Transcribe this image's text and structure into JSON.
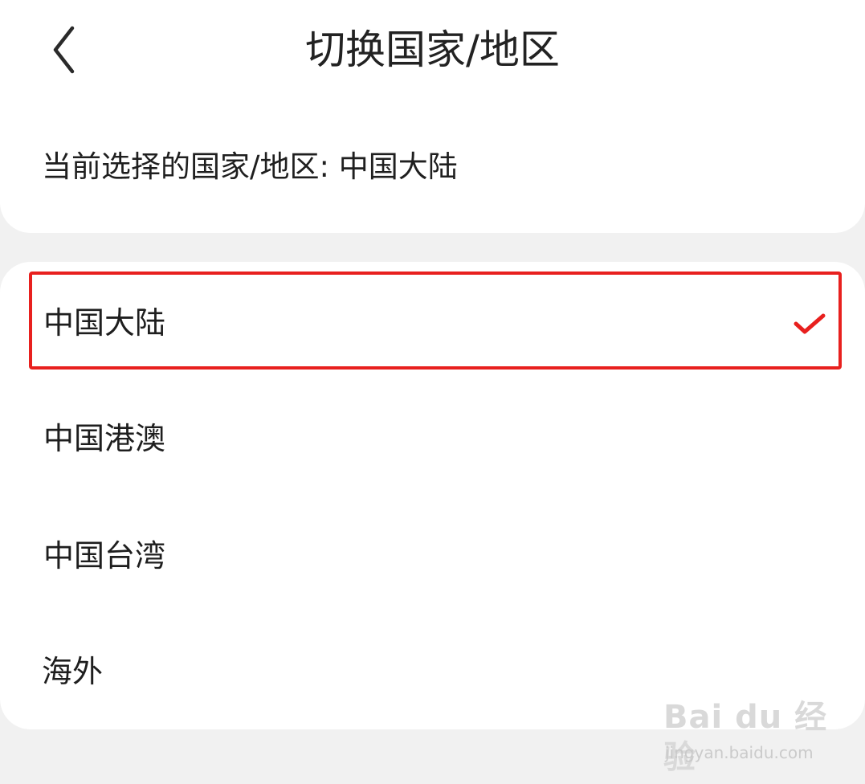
{
  "header": {
    "title": "切换国家/地区",
    "back_icon": "chevron-left-icon"
  },
  "current": {
    "text": "当前选择的国家/地区: 中国大陆"
  },
  "regions": [
    {
      "label": "中国大陆",
      "selected": true
    },
    {
      "label": "中国港澳",
      "selected": false
    },
    {
      "label": "中国台湾",
      "selected": false
    },
    {
      "label": "海外",
      "selected": false
    }
  ],
  "colors": {
    "accent": "#e8201e",
    "highlight_border": "#e8201e",
    "background": "#f1f1f1",
    "card": "#ffffff"
  },
  "watermark": {
    "logo": "Bai du 经验",
    "url": "jingyan.baidu.com"
  }
}
